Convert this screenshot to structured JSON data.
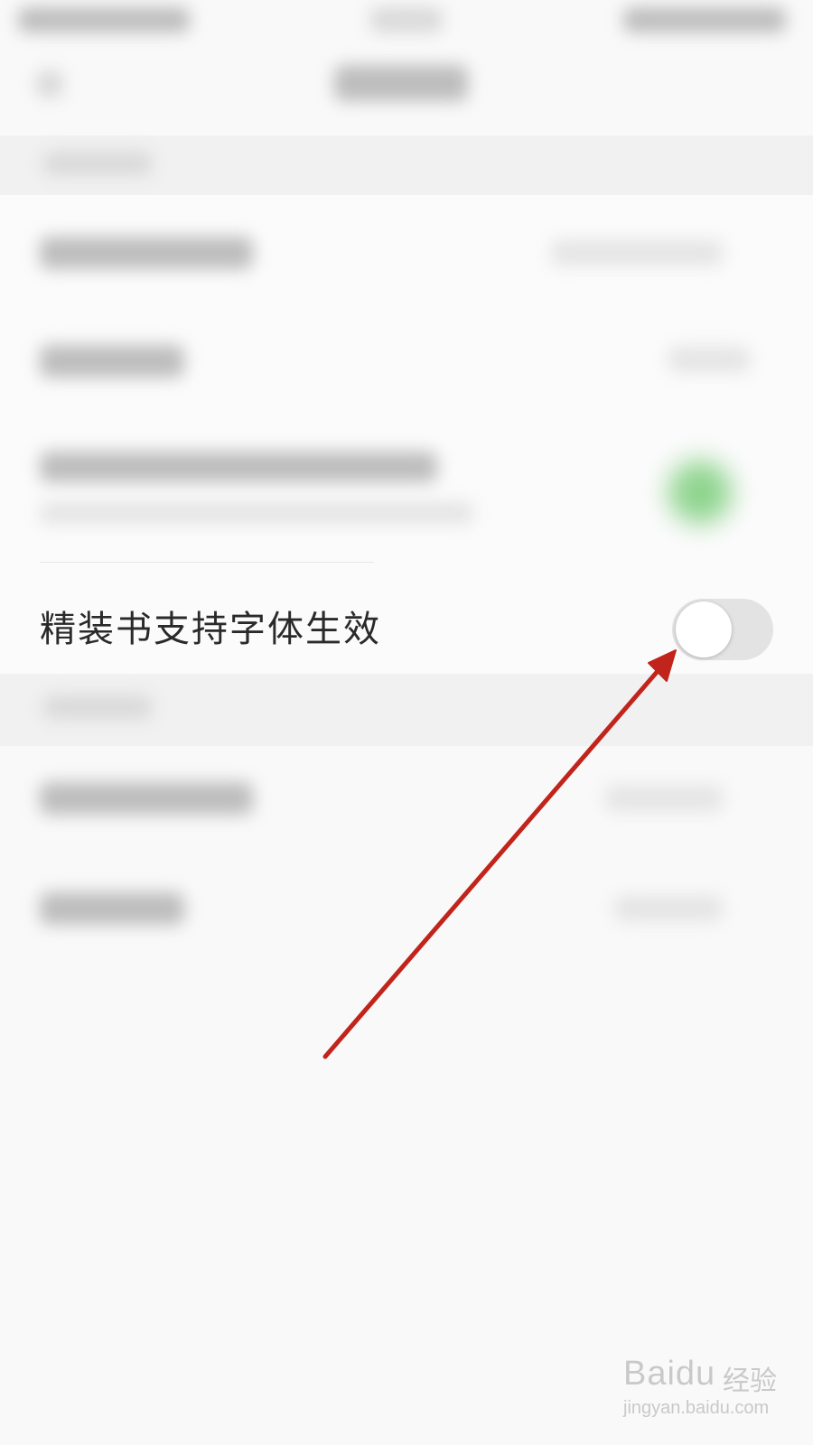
{
  "setting": {
    "label": "精装书支持字体生效",
    "toggle_state": "off"
  },
  "annotation": {
    "arrow_color": "#c0241b"
  },
  "watermark": {
    "brand": "Baidu",
    "brand_cn": "经验",
    "url": "jingyan.baidu.com"
  },
  "colors": {
    "background": "#f9f9f9",
    "toggle_track_off": "#e3e3e3",
    "toggle_knob": "#ffffff",
    "text": "#2a2a2a"
  }
}
